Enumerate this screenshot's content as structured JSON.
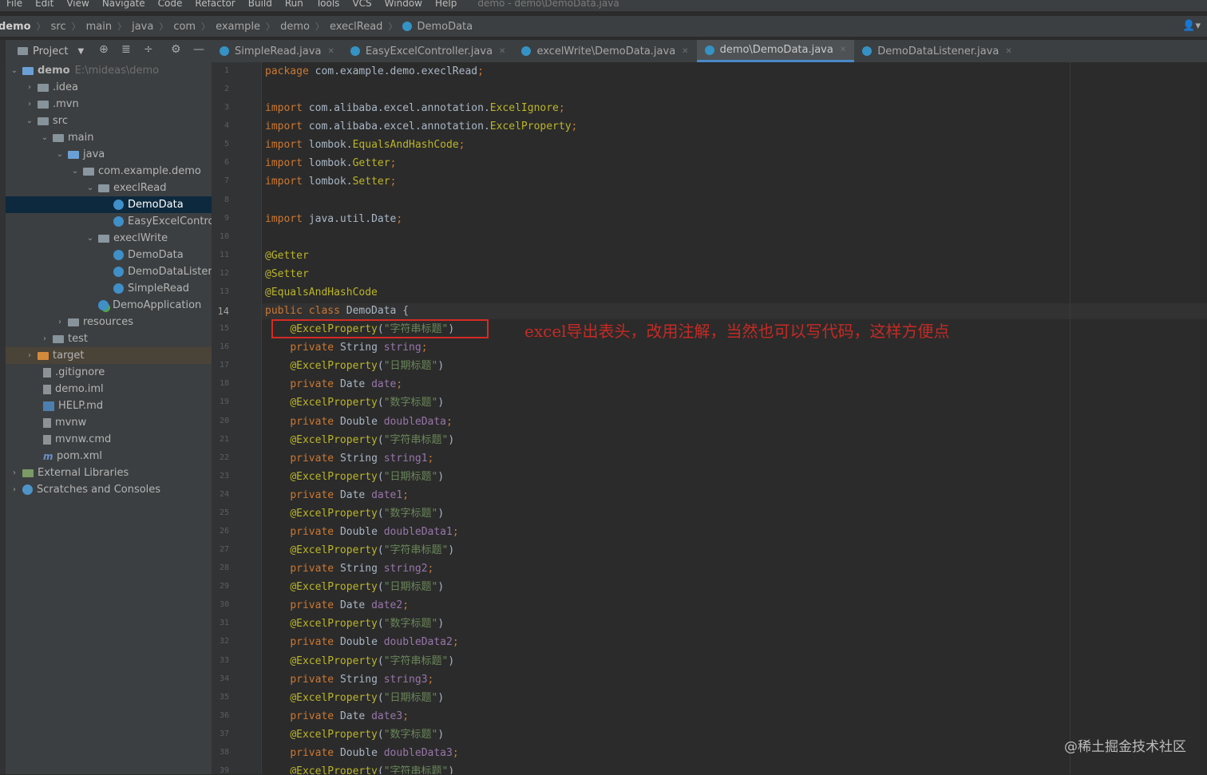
{
  "menu": {
    "items": [
      "File",
      "Edit",
      "View",
      "Navigate",
      "Code",
      "Refactor",
      "Build",
      "Run",
      "Tools",
      "VCS",
      "Window",
      "Help"
    ],
    "window_title": "demo - demo\\DemoData.java"
  },
  "breadcrumbs": [
    "demo",
    "src",
    "main",
    "java",
    "com",
    "example",
    "demo",
    "execlRead",
    "DemoData"
  ],
  "project_toolbar": {
    "label": "Project"
  },
  "tabs": [
    {
      "label": "SimpleRead.java",
      "active": false
    },
    {
      "label": "EasyExcelController.java",
      "active": false
    },
    {
      "label": "excelWrite\\DemoData.java",
      "active": false
    },
    {
      "label": "demo\\DemoData.java",
      "active": true
    },
    {
      "label": "DemoDataListener.java",
      "active": false
    }
  ],
  "tree": {
    "root_label": "demo",
    "root_path": "E:\\mideas\\demo",
    "items": [
      {
        "label": "demo",
        "icon": "module-folder-icon",
        "arrow": "expanded"
      },
      {
        "label": ".idea",
        "icon": "folder-icon",
        "arrow": "collapsed"
      },
      {
        "label": ".mvn",
        "icon": "folder-icon",
        "arrow": "collapsed"
      },
      {
        "label": "src",
        "icon": "folder-icon",
        "arrow": "expanded"
      },
      {
        "label": "main",
        "icon": "folder-icon",
        "arrow": "expanded"
      },
      {
        "label": "java",
        "icon": "source-folder-icon",
        "arrow": "expanded"
      },
      {
        "label": "com.example.demo",
        "icon": "package-icon",
        "arrow": "expanded"
      },
      {
        "label": "execlRead",
        "icon": "package-icon",
        "arrow": "expanded"
      },
      {
        "label": "DemoData",
        "icon": "class-icon",
        "arrow": "none"
      },
      {
        "label": "EasyExcelContro",
        "icon": "class-icon",
        "arrow": "none"
      },
      {
        "label": "execlWrite",
        "icon": "package-icon",
        "arrow": "expanded"
      },
      {
        "label": "DemoData",
        "icon": "class-icon",
        "arrow": "none"
      },
      {
        "label": "DemoDataListen",
        "icon": "class-icon",
        "arrow": "none"
      },
      {
        "label": "SimpleRead",
        "icon": "class-icon",
        "arrow": "none"
      },
      {
        "label": "DemoApplication",
        "icon": "spring-class-icon",
        "arrow": "none"
      },
      {
        "label": "resources",
        "icon": "resources-folder-icon",
        "arrow": "collapsed"
      },
      {
        "label": "test",
        "icon": "folder-icon",
        "arrow": "collapsed"
      },
      {
        "label": "target",
        "icon": "excluded-folder-icon",
        "arrow": "collapsed"
      },
      {
        "label": ".gitignore",
        "icon": "file-icon",
        "arrow": "none"
      },
      {
        "label": "demo.iml",
        "icon": "file-icon",
        "arrow": "none"
      },
      {
        "label": "HELP.md",
        "icon": "markdown-icon",
        "arrow": "none"
      },
      {
        "label": "mvnw",
        "icon": "file-icon",
        "arrow": "none"
      },
      {
        "label": "mvnw.cmd",
        "icon": "file-icon",
        "arrow": "none"
      },
      {
        "label": "pom.xml",
        "icon": "maven-icon",
        "arrow": "none"
      },
      {
        "label": "External Libraries",
        "icon": "library-icon",
        "arrow": "collapsed"
      },
      {
        "label": "Scratches and Consoles",
        "icon": "scratch-icon",
        "arrow": "collapsed"
      }
    ]
  },
  "editor": {
    "current_line": 14,
    "lines": [
      {
        "n": "1",
        "tokens": [
          [
            "kw",
            "package "
          ],
          [
            "plain",
            "com.example.demo.execlRead"
          ],
          [
            "kw",
            ";"
          ]
        ]
      },
      {
        "n": "2",
        "tokens": []
      },
      {
        "n": "3",
        "tokens": [
          [
            "kw",
            "import "
          ],
          [
            "plain",
            "com.alibaba.excel.annotation."
          ],
          [
            "ann",
            "ExcelIgnore"
          ],
          [
            "kw",
            ";"
          ]
        ]
      },
      {
        "n": "4",
        "tokens": [
          [
            "kw",
            "import "
          ],
          [
            "plain",
            "com.alibaba.excel.annotation."
          ],
          [
            "ann",
            "ExcelProperty"
          ],
          [
            "kw",
            ";"
          ]
        ]
      },
      {
        "n": "5",
        "tokens": [
          [
            "kw",
            "import "
          ],
          [
            "plain",
            "lombok."
          ],
          [
            "ann",
            "EqualsAndHashCode"
          ],
          [
            "kw",
            ";"
          ]
        ]
      },
      {
        "n": "6",
        "tokens": [
          [
            "kw",
            "import "
          ],
          [
            "plain",
            "lombok."
          ],
          [
            "ann",
            "Getter"
          ],
          [
            "kw",
            ";"
          ]
        ]
      },
      {
        "n": "7",
        "tokens": [
          [
            "kw",
            "import "
          ],
          [
            "plain",
            "lombok."
          ],
          [
            "ann",
            "Setter"
          ],
          [
            "kw",
            ";"
          ]
        ]
      },
      {
        "n": "8",
        "tokens": []
      },
      {
        "n": "9",
        "tokens": [
          [
            "kw",
            "import "
          ],
          [
            "plain",
            "java.util.Date"
          ],
          [
            "kw",
            ";"
          ]
        ]
      },
      {
        "n": "10",
        "tokens": []
      },
      {
        "n": "11",
        "tokens": [
          [
            "ann",
            "@Getter"
          ]
        ]
      },
      {
        "n": "12",
        "tokens": [
          [
            "ann",
            "@Setter"
          ]
        ]
      },
      {
        "n": "13",
        "tokens": [
          [
            "ann",
            "@EqualsAndHashCode"
          ]
        ]
      },
      {
        "n": "14",
        "tokens": [
          [
            "kw",
            "public class "
          ],
          [
            "plain",
            "DemoData {"
          ]
        ]
      },
      {
        "n": "15",
        "tokens": [
          [
            "plain",
            "    "
          ],
          [
            "ann",
            "@ExcelProperty"
          ],
          [
            "plain",
            "("
          ],
          [
            "str",
            "\"字符串标题\""
          ],
          [
            "plain",
            ")"
          ]
        ]
      },
      {
        "n": "16",
        "tokens": [
          [
            "plain",
            "    "
          ],
          [
            "kw",
            "private "
          ],
          [
            "plain",
            "String "
          ],
          [
            "fld",
            "string"
          ],
          [
            "kw",
            ";"
          ]
        ]
      },
      {
        "n": "17",
        "tokens": [
          [
            "plain",
            "    "
          ],
          [
            "ann",
            "@ExcelProperty"
          ],
          [
            "plain",
            "("
          ],
          [
            "str",
            "\"日期标题\""
          ],
          [
            "plain",
            ")"
          ]
        ]
      },
      {
        "n": "18",
        "tokens": [
          [
            "plain",
            "    "
          ],
          [
            "kw",
            "private "
          ],
          [
            "plain",
            "Date "
          ],
          [
            "fld",
            "date"
          ],
          [
            "kw",
            ";"
          ]
        ]
      },
      {
        "n": "19",
        "tokens": [
          [
            "plain",
            "    "
          ],
          [
            "ann",
            "@ExcelProperty"
          ],
          [
            "plain",
            "("
          ],
          [
            "str",
            "\"数字标题\""
          ],
          [
            "plain",
            ")"
          ]
        ]
      },
      {
        "n": "20",
        "tokens": [
          [
            "plain",
            "    "
          ],
          [
            "kw",
            "private "
          ],
          [
            "plain",
            "Double "
          ],
          [
            "fld",
            "doubleData"
          ],
          [
            "kw",
            ";"
          ]
        ]
      },
      {
        "n": "21",
        "tokens": [
          [
            "plain",
            "    "
          ],
          [
            "ann",
            "@ExcelProperty"
          ],
          [
            "plain",
            "("
          ],
          [
            "str",
            "\"字符串标题\""
          ],
          [
            "plain",
            ")"
          ]
        ]
      },
      {
        "n": "22",
        "tokens": [
          [
            "plain",
            "    "
          ],
          [
            "kw",
            "private "
          ],
          [
            "plain",
            "String "
          ],
          [
            "fld",
            "string1"
          ],
          [
            "kw",
            ";"
          ]
        ]
      },
      {
        "n": "23",
        "tokens": [
          [
            "plain",
            "    "
          ],
          [
            "ann",
            "@ExcelProperty"
          ],
          [
            "plain",
            "("
          ],
          [
            "str",
            "\"日期标题\""
          ],
          [
            "plain",
            ")"
          ]
        ]
      },
      {
        "n": "24",
        "tokens": [
          [
            "plain",
            "    "
          ],
          [
            "kw",
            "private "
          ],
          [
            "plain",
            "Date "
          ],
          [
            "fld",
            "date1"
          ],
          [
            "kw",
            ";"
          ]
        ]
      },
      {
        "n": "25",
        "tokens": [
          [
            "plain",
            "    "
          ],
          [
            "ann",
            "@ExcelProperty"
          ],
          [
            "plain",
            "("
          ],
          [
            "str",
            "\"数字标题\""
          ],
          [
            "plain",
            ")"
          ]
        ]
      },
      {
        "n": "26",
        "tokens": [
          [
            "plain",
            "    "
          ],
          [
            "kw",
            "private "
          ],
          [
            "plain",
            "Double "
          ],
          [
            "fld",
            "doubleData1"
          ],
          [
            "kw",
            ";"
          ]
        ]
      },
      {
        "n": "27",
        "tokens": [
          [
            "plain",
            "    "
          ],
          [
            "ann",
            "@ExcelProperty"
          ],
          [
            "plain",
            "("
          ],
          [
            "str",
            "\"字符串标题\""
          ],
          [
            "plain",
            ")"
          ]
        ]
      },
      {
        "n": "28",
        "tokens": [
          [
            "plain",
            "    "
          ],
          [
            "kw",
            "private "
          ],
          [
            "plain",
            "String "
          ],
          [
            "fld",
            "string2"
          ],
          [
            "kw",
            ";"
          ]
        ]
      },
      {
        "n": "29",
        "tokens": [
          [
            "plain",
            "    "
          ],
          [
            "ann",
            "@ExcelProperty"
          ],
          [
            "plain",
            "("
          ],
          [
            "str",
            "\"日期标题\""
          ],
          [
            "plain",
            ")"
          ]
        ]
      },
      {
        "n": "30",
        "tokens": [
          [
            "plain",
            "    "
          ],
          [
            "kw",
            "private "
          ],
          [
            "plain",
            "Date "
          ],
          [
            "fld",
            "date2"
          ],
          [
            "kw",
            ";"
          ]
        ]
      },
      {
        "n": "31",
        "tokens": [
          [
            "plain",
            "    "
          ],
          [
            "ann",
            "@ExcelProperty"
          ],
          [
            "plain",
            "("
          ],
          [
            "str",
            "\"数字标题\""
          ],
          [
            "plain",
            ")"
          ]
        ]
      },
      {
        "n": "32",
        "tokens": [
          [
            "plain",
            "    "
          ],
          [
            "kw",
            "private "
          ],
          [
            "plain",
            "Double "
          ],
          [
            "fld",
            "doubleData2"
          ],
          [
            "kw",
            ";"
          ]
        ]
      },
      {
        "n": "33",
        "tokens": [
          [
            "plain",
            "    "
          ],
          [
            "ann",
            "@ExcelProperty"
          ],
          [
            "plain",
            "("
          ],
          [
            "str",
            "\"字符串标题\""
          ],
          [
            "plain",
            ")"
          ]
        ]
      },
      {
        "n": "34",
        "tokens": [
          [
            "plain",
            "    "
          ],
          [
            "kw",
            "private "
          ],
          [
            "plain",
            "String "
          ],
          [
            "fld",
            "string3"
          ],
          [
            "kw",
            ";"
          ]
        ]
      },
      {
        "n": "35",
        "tokens": [
          [
            "plain",
            "    "
          ],
          [
            "ann",
            "@ExcelProperty"
          ],
          [
            "plain",
            "("
          ],
          [
            "str",
            "\"日期标题\""
          ],
          [
            "plain",
            ")"
          ]
        ]
      },
      {
        "n": "36",
        "tokens": [
          [
            "plain",
            "    "
          ],
          [
            "kw",
            "private "
          ],
          [
            "plain",
            "Date "
          ],
          [
            "fld",
            "date3"
          ],
          [
            "kw",
            ";"
          ]
        ]
      },
      {
        "n": "37",
        "tokens": [
          [
            "plain",
            "    "
          ],
          [
            "ann",
            "@ExcelProperty"
          ],
          [
            "plain",
            "("
          ],
          [
            "str",
            "\"数字标题\""
          ],
          [
            "plain",
            ")"
          ]
        ]
      },
      {
        "n": "38",
        "tokens": [
          [
            "plain",
            "    "
          ],
          [
            "kw",
            "private "
          ],
          [
            "plain",
            "Double "
          ],
          [
            "fld",
            "doubleData3"
          ],
          [
            "kw",
            ";"
          ]
        ]
      },
      {
        "n": "39",
        "tokens": [
          [
            "plain",
            "    "
          ],
          [
            "ann",
            "@ExcelProperty"
          ],
          [
            "plain",
            "("
          ],
          [
            "str",
            "\"字符串标题\""
          ],
          [
            "plain",
            ")"
          ]
        ]
      }
    ]
  },
  "annotation": {
    "text": "excel导出表头，改用注解，当然也可以写代码，这样方便点",
    "color": "#d62a24"
  },
  "watermark": "@稀土掘金技术社区",
  "colors": {
    "keyword": "#cc7832",
    "annotation": "#bbb529",
    "string": "#6a8759",
    "field": "#9876aa",
    "selection": "#0d293e",
    "tab_underline": "#4a88c7"
  }
}
